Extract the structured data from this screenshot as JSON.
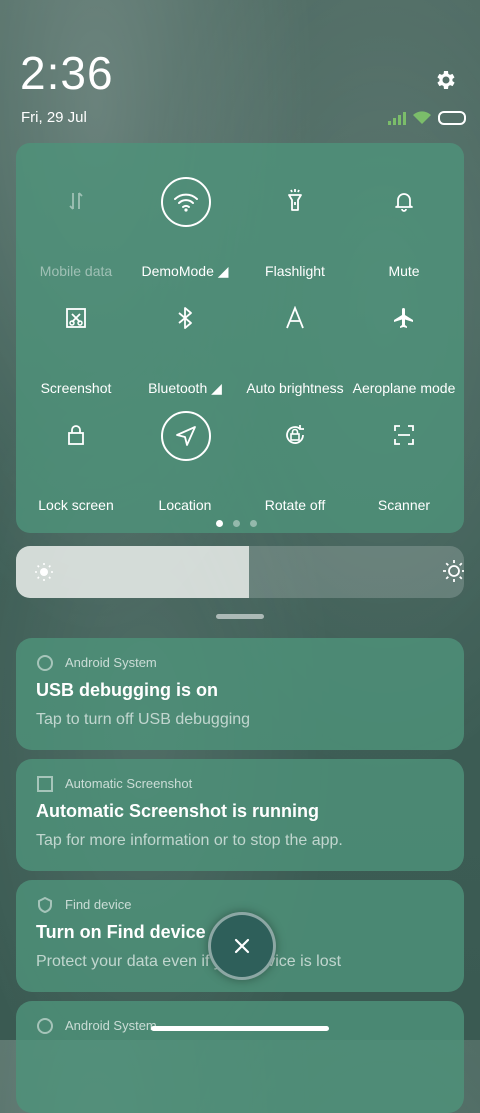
{
  "status": {
    "time": "2:36",
    "date": "Fri, 29 Jul",
    "settings_icon": "gear-icon"
  },
  "quick_settings": {
    "tiles": [
      {
        "label": "Mobile data",
        "icon": "mobile-data-icon",
        "active": false,
        "disabled": true
      },
      {
        "label": "DemoMode ◢",
        "icon": "wifi-icon",
        "active": true,
        "disabled": false
      },
      {
        "label": "Flashlight",
        "icon": "flashlight-icon",
        "active": false,
        "disabled": false
      },
      {
        "label": "Mute",
        "icon": "bell-icon",
        "active": false,
        "disabled": false
      },
      {
        "label": "Screenshot",
        "icon": "screenshot-icon",
        "active": false,
        "disabled": false
      },
      {
        "label": "Bluetooth ◢",
        "icon": "bluetooth-icon",
        "active": false,
        "disabled": false
      },
      {
        "label": "Auto brightness",
        "icon": "auto-brightness-icon",
        "active": false,
        "disabled": false
      },
      {
        "label": "Aeroplane mode",
        "icon": "airplane-icon",
        "active": false,
        "disabled": false
      },
      {
        "label": "Lock screen",
        "icon": "lock-icon",
        "active": false,
        "disabled": false
      },
      {
        "label": "Location",
        "icon": "location-icon",
        "active": true,
        "disabled": false
      },
      {
        "label": "Rotate off",
        "icon": "rotate-icon",
        "active": false,
        "disabled": false
      },
      {
        "label": "Scanner",
        "icon": "scanner-icon",
        "active": false,
        "disabled": false
      }
    ],
    "page_indicator": {
      "pages": 3,
      "current": 1
    }
  },
  "brightness": {
    "level": 0.52
  },
  "notifications": [
    {
      "app": "Android System",
      "title": "USB debugging is on",
      "body": "Tap to turn off USB debugging"
    },
    {
      "app": "Automatic Screenshot",
      "title": "Automatic Screenshot is running",
      "body": "Tap for more information or to stop the app."
    },
    {
      "app": "Find device",
      "title": "Turn on Find device",
      "body": "Protect your data even if your device is lost"
    },
    {
      "app": "Android System",
      "title": "",
      "body": ""
    }
  ],
  "colors": {
    "panel": "#4e927a",
    "clear_button": "#2e5f5a",
    "signal": "#7bbd6a"
  }
}
